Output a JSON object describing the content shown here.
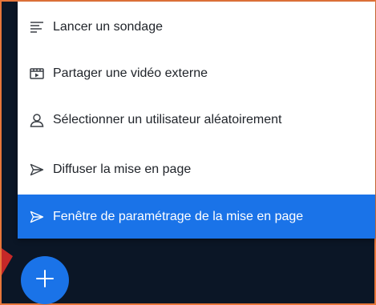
{
  "menu": {
    "items": [
      {
        "label": "Lancer un sondage",
        "icon": "poll-icon"
      },
      {
        "label": "Partager une vidéo externe",
        "icon": "external-video-icon"
      },
      {
        "label": "Sélectionner un utilisateur aléatoirement",
        "icon": "user-icon"
      },
      {
        "label": "Diffuser la mise en page",
        "icon": "send-icon"
      },
      {
        "label": "Fenêtre de paramétrage de la mise en page",
        "icon": "send-icon",
        "active": true
      }
    ]
  },
  "fab": {
    "icon": "plus-icon"
  },
  "colors": {
    "accent": "#1a73e8",
    "background": "#0b1626",
    "highlight_border": "#e8763a",
    "arrow": "#c62828"
  }
}
